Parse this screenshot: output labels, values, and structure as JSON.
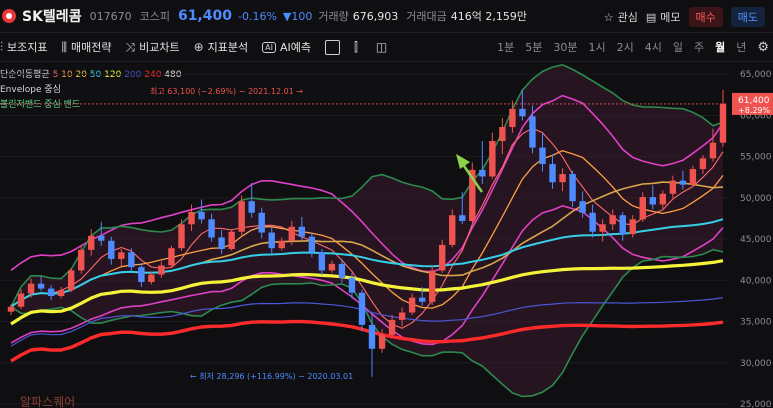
{
  "header": {
    "name": "SK텔레콤",
    "code": "017670",
    "market": "코스피",
    "price": "61,400",
    "change": "-0.16%",
    "change_amount": "▼100",
    "volume_label": "거래량",
    "volume": "676,903",
    "value_label": "거래대금",
    "value": "416억 2,159만",
    "watch": "관심",
    "memo": "메모",
    "buy": "매수",
    "sell": "매도"
  },
  "toolbar": {
    "items": [
      "보조지표",
      "매매전략",
      "비교차트",
      "지표분석",
      "AI예측"
    ],
    "periods": [
      "1분",
      "5분",
      "30분",
      "1시",
      "2시",
      "4시",
      "일",
      "주",
      "월",
      "년"
    ],
    "active_period": "월"
  },
  "legend": {
    "ma_label": "단순이동평균",
    "ma_periods": [
      "5",
      "10",
      "20",
      "50",
      "120",
      "200",
      "240",
      "480"
    ],
    "ma_colors": [
      "#ff6b6b",
      "#ff9f43",
      "#f5c542",
      "#35d0e8",
      "#f4f33a",
      "#4a57d6",
      "#ff2a2a",
      "#e6e6e6"
    ],
    "envelope": "Envelope 중심",
    "bollinger": "볼린저밴드 중심 밴드"
  },
  "annotations": {
    "high": "최고 63,100 (−2.69%) − 2021.12.01 →",
    "low": "← 최저 28,296 (+116.99%) − 2020.03.01",
    "watermark": "알파스퀘어"
  },
  "price_tag": {
    "value": "61,400",
    "pct": "+8.29%"
  },
  "colors": {
    "up": "#ef5350",
    "down": "#4d8bff",
    "bg": "#0f0f11"
  },
  "chart_data": {
    "type": "candlestick",
    "y_ticks": [
      "65,000",
      "60,000",
      "55,000",
      "50,000",
      "45,000",
      "40,000",
      "35,000",
      "30,000",
      "25,000"
    ],
    "ylim": [
      25000,
      66000
    ],
    "candles": [
      [
        36200,
        37100,
        35800,
        36800
      ],
      [
        36800,
        38900,
        36500,
        38400
      ],
      [
        38400,
        40200,
        37900,
        39600
      ],
      [
        39600,
        40500,
        38700,
        39000
      ],
      [
        39000,
        39400,
        37600,
        38100
      ],
      [
        38100,
        39200,
        37800,
        38800
      ],
      [
        38800,
        41500,
        38600,
        41200
      ],
      [
        41200,
        44300,
        40800,
        43700
      ],
      [
        43700,
        46200,
        43000,
        45400
      ],
      [
        45400,
        47100,
        44200,
        44800
      ],
      [
        44800,
        45300,
        41900,
        42600
      ],
      [
        42600,
        43800,
        41700,
        43400
      ],
      [
        43400,
        43900,
        41200,
        41600
      ],
      [
        41600,
        42100,
        39200,
        39800
      ],
      [
        39800,
        41100,
        39500,
        40700
      ],
      [
        40700,
        42300,
        40300,
        41800
      ],
      [
        41800,
        44200,
        41500,
        43900
      ],
      [
        43900,
        47400,
        43600,
        46800
      ],
      [
        46800,
        49200,
        46000,
        48300
      ],
      [
        48300,
        49800,
        46900,
        47400
      ],
      [
        47400,
        48100,
        44700,
        45200
      ],
      [
        45200,
        46100,
        43200,
        43800
      ],
      [
        43800,
        46200,
        43600,
        45900
      ],
      [
        45900,
        50300,
        45500,
        49600
      ],
      [
        49600,
        51800,
        47600,
        48200
      ],
      [
        48200,
        48800,
        45100,
        45800
      ],
      [
        45800,
        46500,
        43300,
        43900
      ],
      [
        43900,
        45200,
        43600,
        44800
      ],
      [
        44800,
        47200,
        44300,
        46500
      ],
      [
        46500,
        47700,
        44900,
        45300
      ],
      [
        45300,
        45800,
        42800,
        43400
      ],
      [
        43400,
        43800,
        40600,
        41200
      ],
      [
        41200,
        42400,
        40900,
        42000
      ],
      [
        42000,
        42600,
        39700,
        40300
      ],
      [
        40300,
        40900,
        37800,
        38500
      ],
      [
        38500,
        38900,
        33800,
        34600
      ],
      [
        34600,
        35900,
        28296,
        31700
      ],
      [
        31700,
        34100,
        31200,
        33400
      ],
      [
        33400,
        35800,
        33100,
        35200
      ],
      [
        35200,
        36700,
        34400,
        36100
      ],
      [
        36100,
        38400,
        35800,
        37900
      ],
      [
        37900,
        39200,
        36900,
        37400
      ],
      [
        37400,
        41800,
        37000,
        41200
      ],
      [
        41200,
        44900,
        40900,
        44300
      ],
      [
        44300,
        48600,
        44000,
        47900
      ],
      [
        47900,
        50700,
        46800,
        47200
      ],
      [
        47200,
        54300,
        47000,
        53400
      ],
      [
        53400,
        56900,
        51700,
        52600
      ],
      [
        52600,
        57900,
        52300,
        56900
      ],
      [
        56900,
        59700,
        55300,
        58600
      ],
      [
        58600,
        61800,
        57900,
        60800
      ],
      [
        60800,
        63100,
        59400,
        59900
      ],
      [
        59900,
        61200,
        55400,
        56100
      ],
      [
        56100,
        57800,
        53200,
        54100
      ],
      [
        54100,
        55300,
        51100,
        51900
      ],
      [
        51900,
        53600,
        50800,
        52900
      ],
      [
        52900,
        53300,
        48900,
        49600
      ],
      [
        49600,
        50800,
        47600,
        48200
      ],
      [
        48200,
        49200,
        45200,
        45900
      ],
      [
        45900,
        47400,
        44700,
        46800
      ],
      [
        46800,
        48600,
        46100,
        47900
      ],
      [
        47900,
        48300,
        44800,
        45600
      ],
      [
        45600,
        47900,
        45200,
        47400
      ],
      [
        47400,
        50700,
        47100,
        50100
      ],
      [
        50100,
        51500,
        48600,
        49200
      ],
      [
        49200,
        50900,
        48700,
        50500
      ],
      [
        50500,
        52700,
        50000,
        52100
      ],
      [
        52100,
        53300,
        51000,
        51600
      ],
      [
        51600,
        53900,
        51400,
        53500
      ],
      [
        53500,
        55200,
        52900,
        54800
      ],
      [
        54800,
        58400,
        54400,
        56700
      ],
      [
        56700,
        63100,
        56200,
        61400
      ]
    ]
  }
}
